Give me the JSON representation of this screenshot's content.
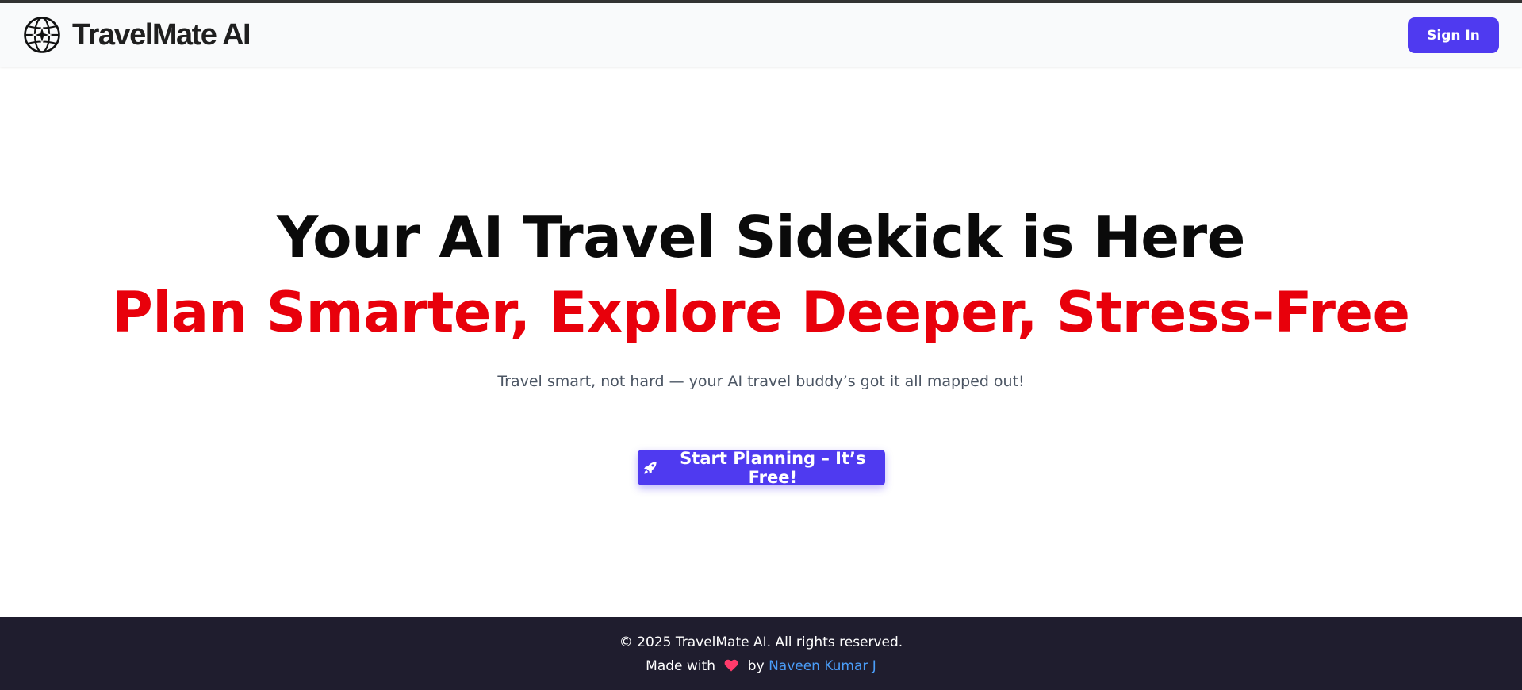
{
  "header": {
    "app_name": "TravelMate AI",
    "logo_icon": "globe-sparkle-icon",
    "sign_in_label": "Sign In"
  },
  "hero": {
    "title": "Your AI Travel Sidekick is Here",
    "subtitle": "Plan Smarter, Explore Deeper, Stress-Free",
    "tagline": "Travel smart, not hard — your AI travel buddy’s got it all mapped out!",
    "cta_label": "Start Planning – It’s Free!",
    "cta_icon": "rocket-icon"
  },
  "footer": {
    "copyright": "© 2025 TravelMate AI. All rights reserved.",
    "made_with_prefix": "Made with",
    "heart_icon": "heart-icon",
    "by_text": "by",
    "author_name": "Naveen Kumar J"
  },
  "colors": {
    "accent": "#4f3af0",
    "headline_red": "#e8000b",
    "footer_bg": "#1f1d2e",
    "link_blue": "#4a9df8"
  }
}
